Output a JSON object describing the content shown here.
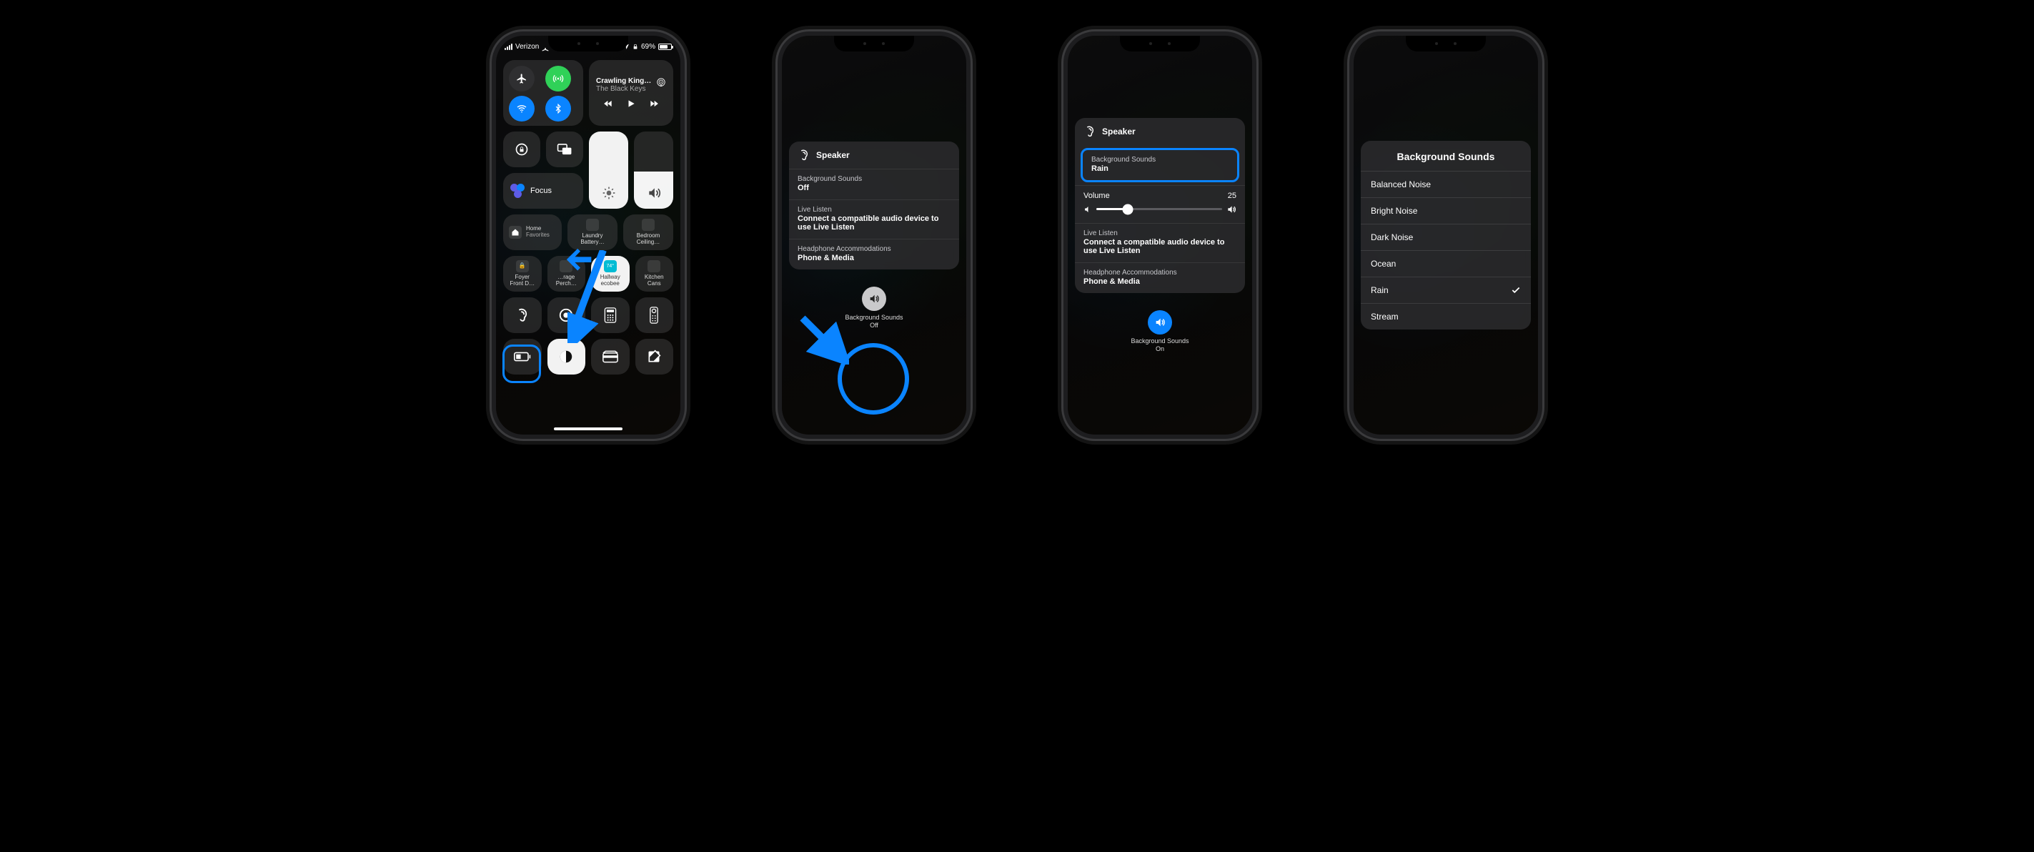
{
  "accent": "#0a84ff",
  "s1": {
    "carrier": "Verizon",
    "battery_pct": "69%",
    "conn": {
      "airplane": false,
      "cellular_on": true,
      "wifi_on": true,
      "bt_on": true
    },
    "nowplaying": {
      "title": "Crawling King…",
      "artist": "The Black Keys"
    },
    "focus": "Focus",
    "tiles_row1": [
      {
        "line1": "Home",
        "line2": "Favorites"
      },
      {
        "line1": "Laundry",
        "line2": "Battery…"
      },
      {
        "line1": "Bedroom",
        "line2": "Ceiling…"
      }
    ],
    "tiles_row2": [
      {
        "line1": "Foyer",
        "line2": "Front D…"
      },
      {
        "line1": "…rage",
        "line2": "Perch…"
      },
      {
        "line1": "Hallway",
        "line2": "ecobee",
        "temp": "74°"
      },
      {
        "line1": "Kitchen",
        "line2": "Cans"
      }
    ]
  },
  "s2": {
    "header": "Speaker",
    "bg_label": "Background Sounds",
    "bg_value": "Off",
    "listen_label": "Live Listen",
    "listen_value": "Connect a compatible audio device to use Live Listen",
    "headphone_label": "Headphone Accommodations",
    "headphone_value": "Phone & Media",
    "toggle_label": "Background Sounds",
    "toggle_state": "Off"
  },
  "s3": {
    "header": "Speaker",
    "bg_label": "Background Sounds",
    "bg_value": "Rain",
    "vol_label": "Volume",
    "vol_value": "25",
    "listen_label": "Live Listen",
    "listen_value": "Connect a compatible audio device to use Live Listen",
    "headphone_label": "Headphone Accommodations",
    "headphone_value": "Phone & Media",
    "toggle_label": "Background Sounds",
    "toggle_state": "On"
  },
  "s4": {
    "title": "Background Sounds",
    "options": [
      "Balanced Noise",
      "Bright Noise",
      "Dark Noise",
      "Ocean",
      "Rain",
      "Stream"
    ],
    "selected": "Rain"
  }
}
